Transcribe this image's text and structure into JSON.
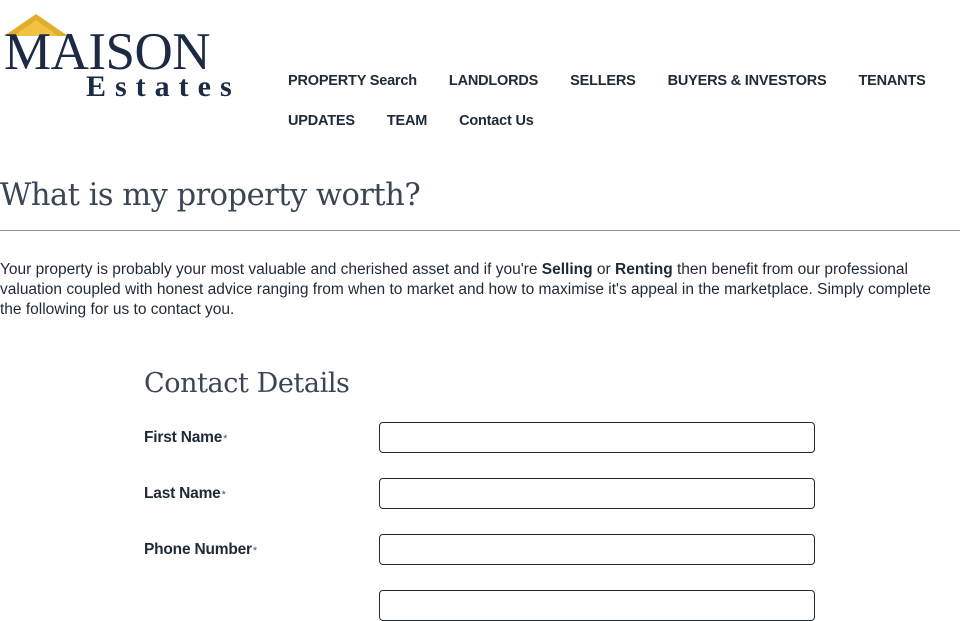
{
  "logo": {
    "line1": "MAISON",
    "line2": "Estates",
    "roof_color": "#e3ad2a",
    "text_color": "#1c2a44"
  },
  "nav": {
    "row1": [
      "PROPERTY Search",
      "LANDLORDS",
      "SELLERS",
      "BUYERS & INVESTORS",
      "TENANTS"
    ],
    "row2": [
      "UPDATES",
      "TEAM",
      "Contact Us"
    ]
  },
  "page": {
    "title": "What is my property worth?",
    "intro": {
      "p1": "Your property is probably your most valuable and cherished asset and if you're ",
      "b1": "Selling",
      "p2": " or ",
      "b2": "Renting",
      "p3": " then benefit from our professional valuation coupled with honest advice ranging from when to market and how to maximise it's appeal in the marketplace. Simply complete the following for us to contact you."
    }
  },
  "form": {
    "section_title": "Contact Details",
    "required_mark": "*",
    "fields": [
      {
        "label": "First Name",
        "value": ""
      },
      {
        "label": "Last Name",
        "value": ""
      },
      {
        "label": "Phone Number",
        "value": ""
      }
    ]
  }
}
